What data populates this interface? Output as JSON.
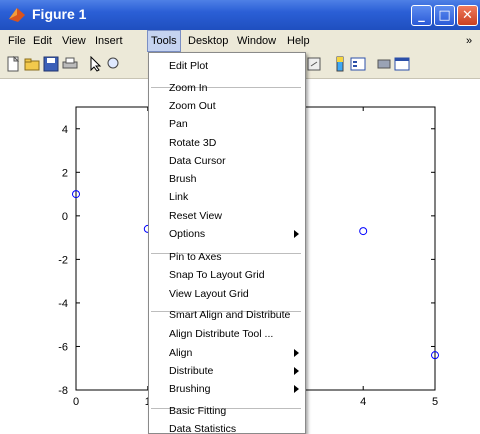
{
  "window": {
    "title": "Figure 1"
  },
  "menubar": {
    "items": [
      "File",
      "Edit",
      "View",
      "Insert",
      "Tools",
      "Desktop",
      "Window",
      "Help"
    ],
    "active": "Tools",
    "overflow": "»"
  },
  "toolbar": {
    "icons": [
      "new-figure-icon",
      "open-file-icon",
      "save-icon",
      "print-icon",
      "pointer-arrow-icon",
      "zoom-icon",
      "link-icon",
      "colorbar-icon",
      "legend-icon",
      "hide-plot-tools-icon",
      "show-plot-tools-icon"
    ]
  },
  "tools_menu": {
    "items": [
      {
        "label": "Edit Plot"
      },
      {
        "label": "Zoom In"
      },
      {
        "label": "Zoom Out"
      },
      {
        "label": "Pan"
      },
      {
        "label": "Rotate 3D"
      },
      {
        "label": "Data Cursor"
      },
      {
        "label": "Brush"
      },
      {
        "label": "Link"
      },
      {
        "label": "Reset View"
      },
      {
        "label": "Options",
        "submenu": true
      },
      {
        "label": "Pin to Axes"
      },
      {
        "label": "Snap To Layout Grid"
      },
      {
        "label": "View Layout Grid"
      },
      {
        "label": "Smart Align and Distribute"
      },
      {
        "label": "Align Distribute Tool ..."
      },
      {
        "label": "Align",
        "submenu": true
      },
      {
        "label": "Distribute",
        "submenu": true
      },
      {
        "label": "Brushing",
        "submenu": true
      },
      {
        "label": "Basic Fitting"
      },
      {
        "label": "Data Statistics"
      }
    ]
  },
  "chart_data": {
    "type": "scatter",
    "xlim": [
      0,
      5
    ],
    "ylim": [
      -8,
      5
    ],
    "x_ticks": [
      "0",
      "1",
      "2",
      "3",
      "4",
      "5"
    ],
    "y_ticks": [
      "-8",
      "-6",
      "-4",
      "-2",
      "0",
      "2",
      "4"
    ],
    "points": [
      {
        "x": 0,
        "y": 1
      },
      {
        "x": 1,
        "y": -0.6
      },
      {
        "x": 4,
        "y": -0.7
      },
      {
        "x": 5,
        "y": -6.4
      }
    ],
    "marker": "circle",
    "color": "#0000ff",
    "grid": false
  }
}
